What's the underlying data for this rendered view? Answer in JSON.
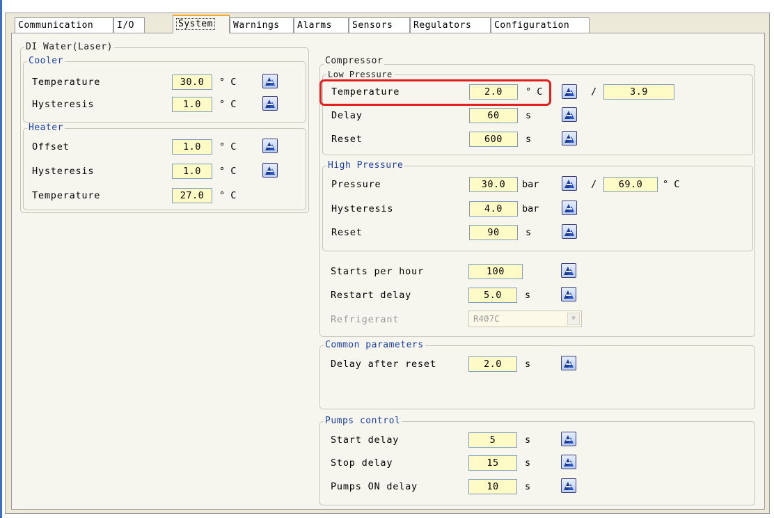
{
  "tabs": [
    "Communication",
    "I/O",
    "System",
    "Warnings",
    "Alarms",
    "Sensors",
    "Regulators",
    "Configuration"
  ],
  "di_water": {
    "title": "DI Water(Laser)",
    "cooler": {
      "title": "Cooler",
      "temperature": {
        "label": "Temperature",
        "value": "30.0",
        "unit": "° C"
      },
      "hysteresis": {
        "label": "Hysteresis",
        "value": "1.0",
        "unit": "° C"
      }
    },
    "heater": {
      "title": "Heater",
      "offset": {
        "label": "Offset",
        "value": "1.0",
        "unit": "° C"
      },
      "hysteresis": {
        "label": "Hysteresis",
        "value": "1.0",
        "unit": "° C"
      },
      "temperature": {
        "label": "Temperature",
        "value": "27.0",
        "unit": "° C"
      }
    }
  },
  "compressor": {
    "title": "Compressor",
    "low_pressure": {
      "title": "Low Pressure",
      "temperature": {
        "label": "Temperature",
        "value": "2.0",
        "unit": "° C",
        "alt_value": "3.9"
      },
      "delay": {
        "label": "Delay",
        "value": "60",
        "unit": "s"
      },
      "reset": {
        "label": "Reset",
        "value": "600",
        "unit": "s"
      }
    },
    "high_pressure": {
      "title": "High Pressure",
      "pressure": {
        "label": "Pressure",
        "value": "30.0",
        "unit": "bar",
        "alt_value": "69.0",
        "alt_unit": "° C"
      },
      "hysteresis": {
        "label": "Hysteresis",
        "value": "4.0",
        "unit": "bar"
      },
      "reset": {
        "label": "Reset",
        "value": "90",
        "unit": "s"
      }
    },
    "starts_per_hour": {
      "label": "Starts per hour",
      "value": "100"
    },
    "restart_delay": {
      "label": "Restart delay",
      "value": "5.0",
      "unit": "s"
    },
    "refrigerant": {
      "label": "Refrigerant",
      "value": "R407C"
    }
  },
  "common": {
    "title": "Common parameters",
    "delay_after_reset": {
      "label": "Delay after reset",
      "value": "2.0",
      "unit": "s"
    }
  },
  "pumps": {
    "title": "Pumps control",
    "start_delay": {
      "label": "Start delay",
      "value": "5",
      "unit": "s"
    },
    "stop_delay": {
      "label": "Stop delay",
      "value": "15",
      "unit": "s"
    },
    "pumps_on_delay": {
      "label": "Pumps ON delay",
      "value": "10",
      "unit": "s"
    }
  },
  "separator": "/",
  "colors": {
    "field_bg": "#fffbc6",
    "group_title": "#1a3fa8",
    "highlight": "#e11d1d",
    "active_tab_accent": "#f5a623"
  },
  "icons": {
    "edit_button": "edit-icon",
    "refrigerant_dropdown": "chevron-down-icon"
  }
}
